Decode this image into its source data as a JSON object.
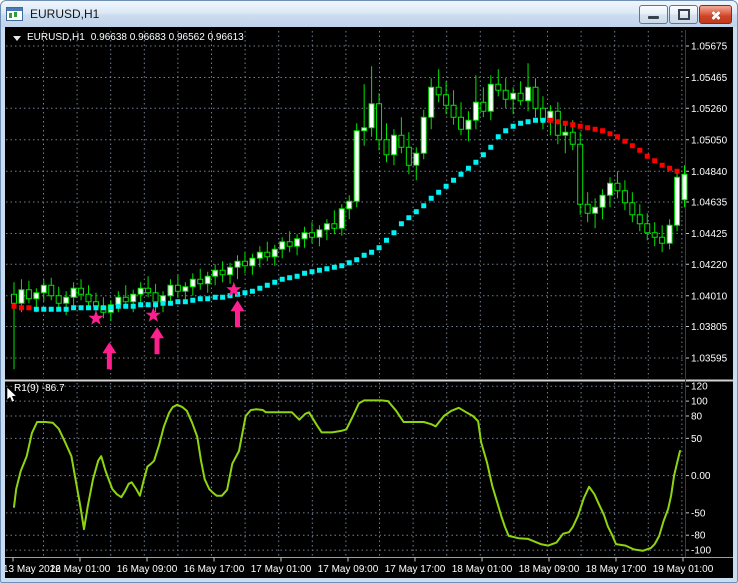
{
  "window": {
    "title": "EURUSD,H1"
  },
  "colors": {
    "background": "#000000",
    "grid": "#73808f",
    "axis_text": "#ffffff",
    "candle_line": "#00e400",
    "bull_body": "#ffffff",
    "bear_body": "#000000",
    "trail_up": "#00f2f2",
    "trail_down": "#ff0000",
    "signal": "#ff2090",
    "indicator_line": "#8ed50f",
    "titlebar_accent": "#cbdcf0",
    "close_button": "#cf4426"
  },
  "main_chart": {
    "symbol_label": "EURUSD,H1",
    "ohlc": "0.96638 0.96683 0.96562 0.96613",
    "price_axis_labels": [
      "1.05675",
      "1.05465",
      "1.05260",
      "1.05050",
      "1.04840",
      "1.04635",
      "1.04425",
      "1.04220",
      "1.04010",
      "1.03805",
      "1.03595"
    ]
  },
  "indicator_panel": {
    "label": "R1(9) -86.7",
    "axis_labels": [
      "120",
      "100",
      "80",
      "50",
      "0.00",
      "-50",
      "-80",
      "-100"
    ],
    "axis_values": [
      120,
      100,
      80,
      50,
      0,
      -50,
      -80,
      -100
    ]
  },
  "time_axis": {
    "labels": [
      "13 May 2022",
      "16 May 01:00",
      "16 May 09:00",
      "16 May 17:00",
      "17 May 01:00",
      "17 May 09:00",
      "17 May 17:00",
      "18 May 01:00",
      "18 May 09:00",
      "18 May 17:00",
      "19 May 01:00"
    ]
  },
  "chart_data": {
    "type": "candlestick",
    "symbol": "EURUSD",
    "timeframe": "H1",
    "ylim": [
      1.03595,
      1.05675
    ],
    "x_labels": [
      "13 May 2022",
      "16 May 01:00",
      "16 May 09:00",
      "16 May 17:00",
      "17 May 01:00",
      "17 May 09:00",
      "17 May 17:00",
      "18 May 01:00",
      "18 May 09:00",
      "18 May 17:00",
      "19 May 01:00"
    ],
    "bars": [
      [
        1.0402,
        1.041,
        1.0352,
        1.0396
      ],
      [
        1.0396,
        1.0412,
        1.039,
        1.0405
      ],
      [
        1.0405,
        1.0411,
        1.0396,
        1.0399
      ],
      [
        1.0399,
        1.0406,
        1.039,
        1.0403
      ],
      [
        1.0403,
        1.0412,
        1.0397,
        1.0408
      ],
      [
        1.0408,
        1.0413,
        1.0398,
        1.0401
      ],
      [
        1.0401,
        1.0407,
        1.0392,
        1.0396
      ],
      [
        1.0396,
        1.0404,
        1.0388,
        1.04
      ],
      [
        1.04,
        1.041,
        1.0394,
        1.0406
      ],
      [
        1.0406,
        1.0412,
        1.0398,
        1.0402
      ],
      [
        1.0402,
        1.0408,
        1.0392,
        1.0397
      ],
      [
        1.0397,
        1.0403,
        1.0389,
        1.0394
      ],
      [
        1.0394,
        1.04,
        1.0386,
        1.039
      ],
      [
        1.039,
        1.0398,
        1.0384,
        1.0395
      ],
      [
        1.0395,
        1.0404,
        1.039,
        1.04
      ],
      [
        1.04,
        1.0408,
        1.0394,
        1.0397
      ],
      [
        1.0397,
        1.0405,
        1.039,
        1.0402
      ],
      [
        1.0402,
        1.041,
        1.0396,
        1.0406
      ],
      [
        1.0406,
        1.0414,
        1.04,
        1.0403
      ],
      [
        1.0403,
        1.0409,
        1.039,
        1.0397
      ],
      [
        1.0397,
        1.0404,
        1.039,
        1.0401
      ],
      [
        1.0401,
        1.0412,
        1.0395,
        1.0408
      ],
      [
        1.0408,
        1.0415,
        1.04,
        1.0404
      ],
      [
        1.0404,
        1.041,
        1.0396,
        1.0407
      ],
      [
        1.0407,
        1.0416,
        1.0401,
        1.0412
      ],
      [
        1.0412,
        1.0419,
        1.0405,
        1.0409
      ],
      [
        1.0409,
        1.0417,
        1.0403,
        1.0414
      ],
      [
        1.0414,
        1.0422,
        1.0408,
        1.0418
      ],
      [
        1.0418,
        1.0424,
        1.041,
        1.0415
      ],
      [
        1.0415,
        1.0423,
        1.0409,
        1.042
      ],
      [
        1.042,
        1.0428,
        1.0412,
        1.0424
      ],
      [
        1.0424,
        1.043,
        1.0416,
        1.0421
      ],
      [
        1.0421,
        1.0429,
        1.0415,
        1.0426
      ],
      [
        1.0426,
        1.0434,
        1.042,
        1.043
      ],
      [
        1.043,
        1.0437,
        1.0424,
        1.0427
      ],
      [
        1.0427,
        1.0435,
        1.0421,
        1.0432
      ],
      [
        1.0432,
        1.044,
        1.0426,
        1.0437
      ],
      [
        1.0437,
        1.0444,
        1.043,
        1.0434
      ],
      [
        1.0434,
        1.0442,
        1.0428,
        1.0439
      ],
      [
        1.0439,
        1.0447,
        1.0433,
        1.0443
      ],
      [
        1.0443,
        1.045,
        1.0436,
        1.044
      ],
      [
        1.044,
        1.0448,
        1.0434,
        1.0445
      ],
      [
        1.0445,
        1.0452,
        1.0438,
        1.0449
      ],
      [
        1.0449,
        1.0458,
        1.0442,
        1.0446
      ],
      [
        1.0446,
        1.0462,
        1.0441,
        1.0459
      ],
      [
        1.0459,
        1.0468,
        1.0452,
        1.0464
      ],
      [
        1.0464,
        1.0516,
        1.046,
        1.0511
      ],
      [
        1.0511,
        1.0542,
        1.0501,
        1.0513
      ],
      [
        1.0513,
        1.0554,
        1.0507,
        1.0529
      ],
      [
        1.0529,
        1.0536,
        1.0498,
        1.0505
      ],
      [
        1.0505,
        1.0516,
        1.049,
        1.0495
      ],
      [
        1.0495,
        1.0512,
        1.0488,
        1.0508
      ],
      [
        1.0508,
        1.052,
        1.0496,
        1.05
      ],
      [
        1.05,
        1.051,
        1.0482,
        1.0488
      ],
      [
        1.0488,
        1.05,
        1.0478,
        1.0496
      ],
      [
        1.0496,
        1.0525,
        1.0492,
        1.052
      ],
      [
        1.052,
        1.0546,
        1.0512,
        1.054
      ],
      [
        1.054,
        1.0552,
        1.053,
        1.0535
      ],
      [
        1.0535,
        1.0544,
        1.0522,
        1.0528
      ],
      [
        1.0528,
        1.0538,
        1.0515,
        1.052
      ],
      [
        1.052,
        1.053,
        1.0508,
        1.0512
      ],
      [
        1.0512,
        1.0524,
        1.0504,
        1.0518
      ],
      [
        1.0518,
        1.0548,
        1.0512,
        1.053
      ],
      [
        1.053,
        1.054,
        1.052,
        1.0524
      ],
      [
        1.0524,
        1.0548,
        1.0518,
        1.0542
      ],
      [
        1.0542,
        1.0552,
        1.0534,
        1.0538
      ],
      [
        1.0538,
        1.0546,
        1.0526,
        1.0532
      ],
      [
        1.0532,
        1.054,
        1.0522,
        1.0536
      ],
      [
        1.0536,
        1.0544,
        1.0528,
        1.0531
      ],
      [
        1.0531,
        1.0556,
        1.0524,
        1.054
      ],
      [
        1.054,
        1.0546,
        1.052,
        1.0526
      ],
      [
        1.0526,
        1.0534,
        1.0512,
        1.0518
      ],
      [
        1.0518,
        1.0528,
        1.0508,
        1.0524
      ],
      [
        1.0524,
        1.053,
        1.0502,
        1.0508
      ],
      [
        1.0508,
        1.0516,
        1.0496,
        1.051
      ],
      [
        1.051,
        1.0518,
        1.0498,
        1.0502
      ],
      [
        1.0502,
        1.051,
        1.0455,
        1.0462
      ],
      [
        1.0462,
        1.047,
        1.045,
        1.0456
      ],
      [
        1.0456,
        1.0466,
        1.0446,
        1.046
      ],
      [
        1.046,
        1.0472,
        1.0452,
        1.0468
      ],
      [
        1.0468,
        1.048,
        1.046,
        1.0476
      ],
      [
        1.0476,
        1.0484,
        1.0466,
        1.0471
      ],
      [
        1.0471,
        1.0478,
        1.0458,
        1.0463
      ],
      [
        1.0463,
        1.047,
        1.045,
        1.0455
      ],
      [
        1.0455,
        1.0462,
        1.0444,
        1.0449
      ],
      [
        1.0449,
        1.0456,
        1.0438,
        1.0443
      ],
      [
        1.0443,
        1.045,
        1.0434,
        1.044
      ],
      [
        1.044,
        1.0448,
        1.043,
        1.0436
      ],
      [
        1.0436,
        1.0452,
        1.0432,
        1.0448
      ],
      [
        1.0448,
        1.0484,
        1.0444,
        1.048
      ],
      [
        1.0465,
        1.0488,
        1.046,
        1.0482
      ]
    ],
    "trail": {
      "values": [
        1.0394,
        1.0393,
        1.0393,
        1.0392,
        1.0392,
        1.0392,
        1.0392,
        1.0392,
        1.0393,
        1.0393,
        1.0393,
        1.0393,
        1.0393,
        1.0393,
        1.0394,
        1.0394,
        1.0394,
        1.0395,
        1.0395,
        1.0395,
        1.0396,
        1.0396,
        1.0397,
        1.0397,
        1.0398,
        1.0399,
        1.0399,
        1.04,
        1.04,
        1.0401,
        1.0402,
        1.0403,
        1.0404,
        1.0406,
        1.0408,
        1.041,
        1.0412,
        1.0413,
        1.0414,
        1.0416,
        1.0417,
        1.0418,
        1.0419,
        1.042,
        1.0421,
        1.0423,
        1.0425,
        1.0428,
        1.043,
        1.0433,
        1.0438,
        1.0443,
        1.0449,
        1.0453,
        1.0457,
        1.0461,
        1.0466,
        1.047,
        1.0474,
        1.0478,
        1.0482,
        1.0486,
        1.049,
        1.0495,
        1.05,
        1.0507,
        1.0511,
        1.0514,
        1.0516,
        1.0517,
        1.0518,
        1.0518,
        1.0518,
        1.0517,
        1.0516,
        1.0515,
        1.0514,
        1.0513,
        1.0512,
        1.0511,
        1.0509,
        1.0507,
        1.0504,
        1.0501,
        1.0498,
        1.0494,
        1.0491,
        1.0488,
        1.0486,
        1.0484
      ],
      "segments": [
        {
          "from": 0,
          "to": 2,
          "dir": "down"
        },
        {
          "from": 3,
          "to": 71,
          "dir": "up"
        },
        {
          "from": 72,
          "to": 89,
          "dir": "down"
        }
      ]
    },
    "signals": [
      {
        "star_bar": 11.0,
        "star_price": 1.0386,
        "arrow_bar": 12.8,
        "arrow_price": 1.037
      },
      {
        "star_bar": 18.7,
        "star_price": 1.0388,
        "arrow_bar": 19.2,
        "arrow_price": 1.038
      },
      {
        "star_bar": 29.5,
        "star_price": 1.0405,
        "arrow_bar": 30.0,
        "arrow_price": 1.0398
      }
    ],
    "indicator": {
      "name": "R1",
      "period": 9,
      "current": -86.7,
      "ylim": [
        -120,
        120
      ],
      "levels": [
        120,
        100,
        80,
        50,
        0,
        -50,
        -80,
        -100
      ],
      "points": [
        [
          0,
          -42
        ],
        [
          0.3,
          -18
        ],
        [
          0.9,
          6
        ],
        [
          1.7,
          26
        ],
        [
          2.4,
          57
        ],
        [
          3.1,
          72
        ],
        [
          4.2,
          72
        ],
        [
          5.2,
          71
        ],
        [
          6,
          63
        ],
        [
          6.8,
          46
        ],
        [
          7.7,
          26
        ],
        [
          8.3,
          -7
        ],
        [
          8.9,
          -41
        ],
        [
          9.4,
          -72
        ],
        [
          9.9,
          -41
        ],
        [
          10.6,
          -5
        ],
        [
          11.3,
          20
        ],
        [
          11.7,
          26
        ],
        [
          12.3,
          6
        ],
        [
          13.2,
          -18
        ],
        [
          13.8,
          -25
        ],
        [
          14.4,
          -29
        ],
        [
          14.9,
          -21
        ],
        [
          15.4,
          -11
        ],
        [
          15.8,
          -9
        ],
        [
          16.4,
          -18
        ],
        [
          16.9,
          -27
        ],
        [
          17.4,
          -7
        ],
        [
          17.9,
          12
        ],
        [
          18.4,
          16
        ],
        [
          18.8,
          20
        ],
        [
          19.5,
          42
        ],
        [
          20.1,
          65
        ],
        [
          20.8,
          84
        ],
        [
          21.3,
          92
        ],
        [
          21.9,
          95
        ],
        [
          22.6,
          92
        ],
        [
          23.2,
          87
        ],
        [
          23.9,
          71
        ],
        [
          24.6,
          52
        ],
        [
          25.1,
          20
        ],
        [
          25.6,
          -5
        ],
        [
          26.2,
          -18
        ],
        [
          26.7,
          -23
        ],
        [
          27.2,
          -27
        ],
        [
          27.9,
          -27
        ],
        [
          28.6,
          -19
        ],
        [
          29.3,
          16
        ],
        [
          30.2,
          33
        ],
        [
          31.1,
          80
        ],
        [
          31.8,
          88
        ],
        [
          32.5,
          89
        ],
        [
          33.4,
          88
        ],
        [
          33.8,
          85
        ],
        [
          34.6,
          85
        ],
        [
          35.8,
          85
        ],
        [
          37.3,
          85
        ],
        [
          38.3,
          75
        ],
        [
          39.1,
          83
        ],
        [
          39.6,
          85
        ],
        [
          40.7,
          67
        ],
        [
          41.3,
          58
        ],
        [
          42.7,
          58
        ],
        [
          43.9,
          60
        ],
        [
          44.6,
          62
        ],
        [
          45.5,
          80
        ],
        [
          46.3,
          97
        ],
        [
          47,
          101
        ],
        [
          49.3,
          101
        ],
        [
          50.2,
          100
        ],
        [
          51.3,
          87
        ],
        [
          52.3,
          72
        ],
        [
          53.3,
          72
        ],
        [
          55,
          72
        ],
        [
          56,
          69
        ],
        [
          56.6,
          66
        ],
        [
          57.7,
          80
        ],
        [
          58.7,
          87
        ],
        [
          59.7,
          91
        ],
        [
          60.7,
          85
        ],
        [
          61.6,
          80
        ],
        [
          62.3,
          73
        ],
        [
          62.7,
          45
        ],
        [
          63.5,
          17
        ],
        [
          64.2,
          -14
        ],
        [
          64.8,
          -34
        ],
        [
          65.4,
          -54
        ],
        [
          65.9,
          -69
        ],
        [
          66.4,
          -81
        ],
        [
          67.7,
          -84
        ],
        [
          69,
          -85
        ],
        [
          70.7,
          -92
        ],
        [
          71.7,
          -94
        ],
        [
          72.8,
          -90
        ],
        [
          73.7,
          -78
        ],
        [
          74.5,
          -76
        ],
        [
          75,
          -69
        ],
        [
          75.7,
          -54
        ],
        [
          76.5,
          -30
        ],
        [
          77.2,
          -15
        ],
        [
          77.9,
          -25
        ],
        [
          78.5,
          -38
        ],
        [
          79.2,
          -53
        ],
        [
          79.7,
          -68
        ],
        [
          80.3,
          -80
        ],
        [
          80.8,
          -92
        ],
        [
          82.1,
          -94
        ],
        [
          83.2,
          -99
        ],
        [
          84.4,
          -101
        ],
        [
          85.5,
          -97
        ],
        [
          86,
          -92
        ],
        [
          86.6,
          -81
        ],
        [
          87.2,
          -61
        ],
        [
          87.8,
          -45
        ],
        [
          88.2,
          -27
        ],
        [
          88.6,
          0
        ],
        [
          89,
          17
        ],
        [
          89.4,
          33
        ]
      ]
    }
  }
}
